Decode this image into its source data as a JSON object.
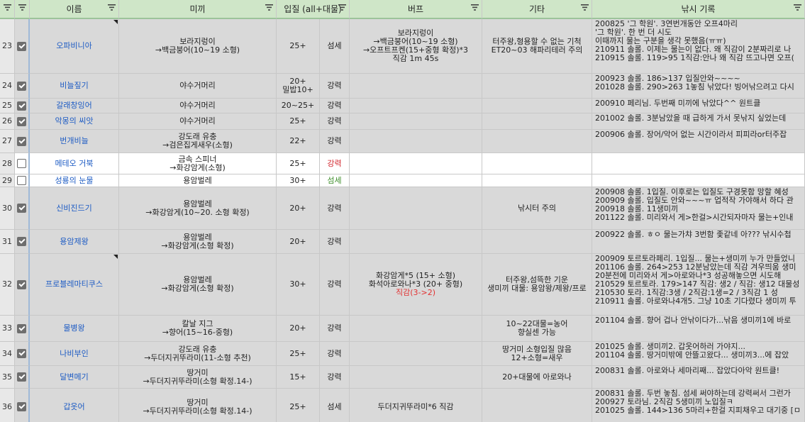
{
  "header": {
    "name": "이름",
    "bait": "미끼",
    "depth": "입질 (all+대물)",
    "buff": "버프",
    "etc": "기타",
    "record": "낚시 기록"
  },
  "rows": [
    {
      "num": "23",
      "checked": true,
      "name": "오파비니아",
      "bait": [
        "보라지렁이",
        "→백금붕어(10~19 소형)"
      ],
      "depth": [
        "25+"
      ],
      "grade": "섬세",
      "gradeColor": "normal",
      "buff": [
        "보라지렁이",
        "→백금붕어(10~19 소형)",
        "→오프트프켄(15+중형 확정)*3",
        "직감 1m 45s"
      ],
      "etc": [
        "터주왕,형용할 수 없는 기척",
        "ET20~03 해파리테러 주의"
      ],
      "record": [
        "200825 '그 학원'. 3연번개동안 오프4마리",
        "'그 학원'. 한 번 더 시도",
        "이때까지 물는 구분을 생각 못했음(ㅠㅠ)",
        "210911 솔롤. 이제는 물는이 없다. 왜 직감이 2분짜리로 나",
        "210915 솔롤. 119>95 1직감:안나 왜 직감 뜨고나면 오프("
      ],
      "mark": true
    },
    {
      "num": "24",
      "checked": true,
      "name": "비늘짚기",
      "bait": [
        "야수거머리"
      ],
      "depth": [
        "20+",
        "밀밥10+"
      ],
      "grade": "강력",
      "gradeColor": "normal",
      "buff": [],
      "etc": [],
      "record": [
        "200923 솔롤. 186>137 입질안와~~~~",
        "201028 솔롤. 290>263 1놓침 낚았다! 빙어낚으려고 다시"
      ]
    },
    {
      "num": "25",
      "checked": true,
      "name": "갈래창잉어",
      "bait": [
        "야수거머리"
      ],
      "depth": [
        "20~25+"
      ],
      "grade": "강력",
      "gradeColor": "normal",
      "buff": [],
      "etc": [],
      "record": [
        "200910 페리님. 두번째 미끼에 낚았다^^ 원트클"
      ]
    },
    {
      "num": "26",
      "checked": true,
      "name": "악몽의 씨앗",
      "bait": [
        "야수거머리"
      ],
      "depth": [
        "25+"
      ],
      "grade": "강력",
      "gradeColor": "normal",
      "buff": [],
      "etc": [],
      "record": [
        "201002 솔롤. 3분남았을 때 급하게 가서 못낚지 싶었는데"
      ]
    },
    {
      "num": "27",
      "checked": true,
      "name": "번개비늘",
      "bait": [
        "강도래 유충",
        "→검은집게새우(소형)"
      ],
      "depth": [
        "22+"
      ],
      "grade": "강력",
      "gradeColor": "normal",
      "buff": [],
      "etc": [],
      "record": [
        "200906 솔롤. 장어/악어 없는 시간이라서 피피라or터주잡"
      ]
    },
    {
      "num": "28",
      "checked": false,
      "name": "메테오 거북",
      "bait": [
        "금속 스피너",
        "→화강암게(소형)"
      ],
      "depth": [
        "25+"
      ],
      "grade": "강력",
      "gradeColor": "red",
      "buff": [],
      "etc": [],
      "record": []
    },
    {
      "num": "29",
      "checked": false,
      "name": "성룡의 눈물",
      "bait": [
        "용암벌레"
      ],
      "depth": [
        "30+"
      ],
      "grade": "섬세",
      "gradeColor": "green",
      "buff": [],
      "etc": [],
      "record": []
    },
    {
      "num": "30",
      "checked": true,
      "name": "신비진드기",
      "bait": [
        "용암벌레",
        "→화강암게(10~20. 소형 확정)"
      ],
      "depth": [
        "20+"
      ],
      "grade": "강력",
      "gradeColor": "normal",
      "buff": [],
      "etc": [
        "낚시터 주의"
      ],
      "record": [
        "200908 솔롤. 1입질. 이후로는 입질도 구경못함 망할 혜성",
        "200909 솔롤. 입질도 안와~~~ㅠ 업적작 가야해서 하다 관",
        "200918 솔롤. 11생미끼",
        "201122 솔롤. 미리와서 게>한걸>시간되자마자 물는+인내"
      ]
    },
    {
      "num": "31",
      "checked": true,
      "name": "용암제왕",
      "bait": [
        "용암벌레",
        "→화강암게(소형 확정)"
      ],
      "depth": [
        "20+"
      ],
      "grade": "강력",
      "gradeColor": "normal",
      "buff": [],
      "etc": [],
      "record": [
        "200922 솔롤. ㅎㅇ 물는가챠 3번함 좇같네 아??? 낚시수첩"
      ]
    },
    {
      "num": "32",
      "checked": true,
      "name": "프로블레마티쿠스",
      "bait": [
        "용암벌레",
        "→화강암게(소형 확정)"
      ],
      "depth": [
        "30+"
      ],
      "grade": "강력",
      "gradeColor": "normal",
      "buff": [
        "화강암게*5 (15+ 소형)",
        "화석아로와나*3 (20+ 중형)",
        "직감(3->2)"
      ],
      "buffRedLast": true,
      "etc": [
        "터주왕,섬뜩한 기운",
        "생미끼 대물: 용암왕/제왕/프로"
      ],
      "record": [
        "200909 토르토라페리. 1입질... 물는+생미끼 누가 만들었니",
        "201106 솔롤. 264>253 12분남았는데 직감 겨우띄움 생미",
        "20분전에 미리와서 게>아로와나*3 성공해놓으면 시도해",
        "210529 토르토라. 179>147 직감: 생2 / 직감: 생12 대물성",
        "210530 토라. 1직감:3생 / 2직감:1생=2 / 3직감 1 성",
        "210911 솔롤. 아로와나4개5. 그냥 10초 기다렸다 생미끼 투"
      ],
      "mark": true
    },
    {
      "num": "33",
      "checked": true,
      "name": "물병왕",
      "bait": [
        "칼날 지그",
        "→향어(15~16-중형)"
      ],
      "depth": [
        "20+"
      ],
      "grade": "강력",
      "gradeColor": "normal",
      "buff": [],
      "etc": [
        "10~22대물=농어",
        "향실센 가능"
      ],
      "record": [
        "201104 솔롤. 향어 겁나 안낚이다가...낚음 생미끼1에 바로"
      ]
    },
    {
      "num": "34",
      "checked": true,
      "name": "나비부인",
      "bait": [
        "강도래 유충",
        "→두더지귀뚜라미(11-소형 추천)"
      ],
      "depth": [
        "25+"
      ],
      "grade": "강력",
      "gradeColor": "normal",
      "buff": [],
      "etc": [
        "땅거미 소형입질 많음",
        "12+소형=새우"
      ],
      "record": [
        "201025 솔롤. 생미끼2. 갑옷어하러 가야지...",
        "201104 솔롤. 땅거미밖에 안뜰고왔다... 생미끼3...에 잡았"
      ]
    },
    {
      "num": "35",
      "checked": true,
      "name": "달변메기",
      "bait": [
        "땅거미",
        "→두더지귀뚜라미(소형 확정.14-)"
      ],
      "depth": [
        "15+"
      ],
      "grade": "강력",
      "gradeColor": "normal",
      "buff": [],
      "etc": [
        "20+대물에 아로와나"
      ],
      "record": [
        "200831 솔롤. 아로와나 세마리째... 잡았다아악 원트클!"
      ]
    },
    {
      "num": "36",
      "checked": true,
      "name": "갑옷어",
      "bait": [
        "땅거미",
        "→두더지귀뚜라미(소형 확정.14-)"
      ],
      "depth": [
        "25+"
      ],
      "grade": "섬세",
      "gradeColor": "normal",
      "buff": [
        "두더지귀뚜라미*6 직감"
      ],
      "etc": [],
      "record": [
        "200831 솔롤. 두번 놓침. 섬세 써야하는데 강력써서 그런가",
        "200927 토라님. 2직감 5생미끼 노입질ㅋ",
        "201025 솔롤. 144>136 5마리+한걸 지피채우고 대기중 [ㅁ"
      ]
    }
  ]
}
